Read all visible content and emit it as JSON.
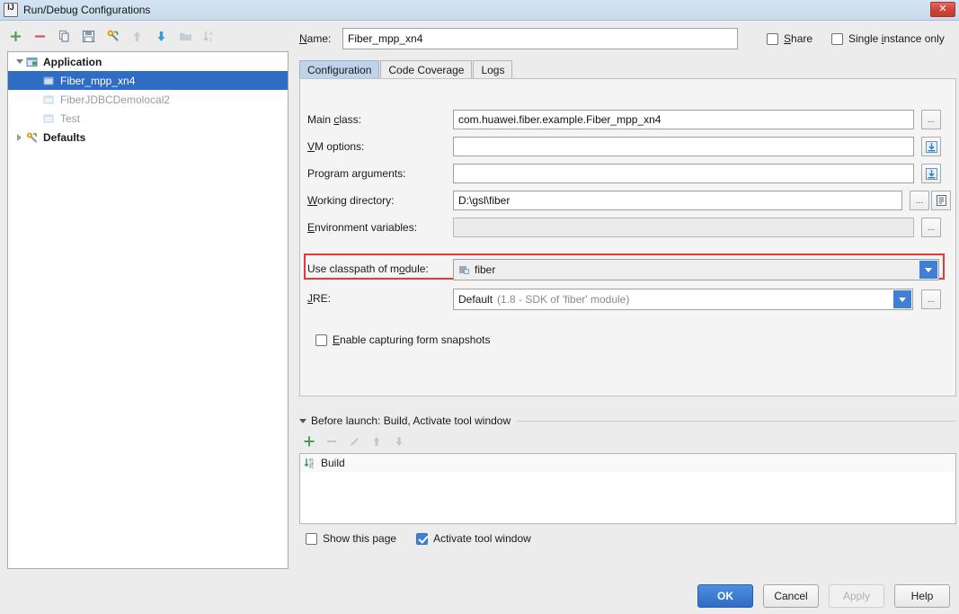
{
  "window": {
    "title": "Run/Debug Configurations",
    "app_icon": "intellij-icon",
    "close_label": "✕"
  },
  "toolbar": {
    "items": [
      {
        "name": "add-icon",
        "tooltip": "Add New Configuration"
      },
      {
        "name": "remove-icon",
        "tooltip": "Remove Configuration"
      },
      {
        "name": "copy-icon",
        "tooltip": "Copy Configuration"
      },
      {
        "name": "save-icon",
        "tooltip": "Save Configuration"
      },
      {
        "name": "edit-templates-icon",
        "tooltip": "Edit Templates"
      },
      {
        "name": "move-up-icon",
        "tooltip": "Move Up"
      },
      {
        "name": "move-down-icon",
        "tooltip": "Move Down"
      },
      {
        "name": "folder-icon",
        "tooltip": "Create New Folder"
      },
      {
        "name": "sort-icon",
        "tooltip": "Sort Configurations"
      }
    ]
  },
  "tree": {
    "nodes": [
      {
        "label": "Application",
        "level": 0,
        "expanded": true,
        "bold": true,
        "dim": false,
        "selected": false,
        "icon": "application-icon"
      },
      {
        "label": "Fiber_mpp_xn4",
        "level": 1,
        "expanded": null,
        "bold": false,
        "dim": false,
        "selected": true,
        "icon": "config-icon"
      },
      {
        "label": "FiberJDBCDemolocal2",
        "level": 1,
        "expanded": null,
        "bold": false,
        "dim": true,
        "selected": false,
        "icon": "config-icon"
      },
      {
        "label": "Test",
        "level": 1,
        "expanded": null,
        "bold": false,
        "dim": true,
        "selected": false,
        "icon": "config-icon"
      },
      {
        "label": "Defaults",
        "level": 0,
        "expanded": false,
        "bold": true,
        "dim": false,
        "selected": false,
        "icon": "defaults-icon"
      }
    ]
  },
  "name_row": {
    "label": "Name:",
    "value": "Fiber_mpp_xn4",
    "placeholder": "",
    "share": {
      "label": "Share",
      "checked": false
    },
    "single_instance": {
      "label": "Single instance only",
      "checked": false
    }
  },
  "tabs": [
    {
      "label": "Configuration",
      "active": true
    },
    {
      "label": "Code Coverage",
      "active": false
    },
    {
      "label": "Logs",
      "active": false
    }
  ],
  "fields": {
    "main_class": {
      "label": "Main class:",
      "value": "com.huawei.fiber.example.Fiber_mpp_xn4",
      "browse": "..."
    },
    "vm_options": {
      "label": "VM options:",
      "value": "",
      "expand_icon": "expand-editor-icon"
    },
    "program_arguments": {
      "label": "Program arguments:",
      "value": "",
      "expand_icon": "expand-editor-icon"
    },
    "working_directory": {
      "label": "Working directory:",
      "value": "D:\\gsl\\fiber",
      "browse": "...",
      "macro_icon": "macros-icon"
    },
    "environment_variables": {
      "label": "Environment variables:",
      "value": "",
      "browse": "...",
      "highlighted": true,
      "highlight_color": "#e03a3a"
    },
    "use_classpath_of_module": {
      "label": "Use classpath of module:",
      "value": "fiber",
      "icon": "module-icon"
    },
    "jre": {
      "label": "JRE:",
      "value": "Default",
      "hint": "(1.8 - SDK of 'fiber' module)",
      "browse": "..."
    },
    "enable_capturing": {
      "label": "Enable capturing form snapshots",
      "checked": false
    }
  },
  "before_launch": {
    "header": "Before launch: Build, Activate tool window",
    "toolbar": [
      {
        "name": "add-task-icon",
        "enabled": true
      },
      {
        "name": "remove-task-icon",
        "enabled": false
      },
      {
        "name": "edit-task-icon",
        "enabled": false
      },
      {
        "name": "move-task-up-icon",
        "enabled": false
      },
      {
        "name": "move-task-down-icon",
        "enabled": false
      }
    ],
    "tasks": [
      {
        "label": "Build",
        "icon": "build-icon"
      }
    ],
    "show_this_page": {
      "label": "Show this page",
      "checked": false
    },
    "activate_tool_window": {
      "label": "Activate tool window",
      "checked": true
    }
  },
  "dialog_buttons": {
    "ok": {
      "label": "OK",
      "primary": true,
      "enabled": true
    },
    "cancel": {
      "label": "Cancel",
      "primary": false,
      "enabled": true
    },
    "apply": {
      "label": "Apply",
      "primary": false,
      "enabled": false
    },
    "help": {
      "label": "Help",
      "primary": false,
      "enabled": true
    }
  },
  "colors": {
    "accent": "#2f6cc4",
    "selection": "#2f6cc4",
    "highlight": "#e03a3a",
    "titlebar": "#cfe0ef",
    "window_bg": "#ececec"
  }
}
